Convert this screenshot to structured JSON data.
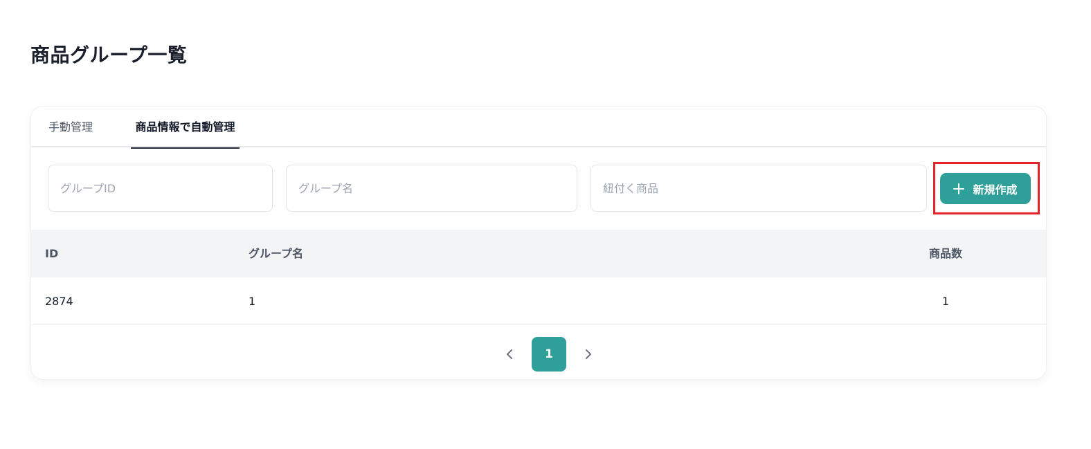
{
  "page": {
    "title": "商品グループ一覧"
  },
  "tabs": [
    {
      "label": "手動管理",
      "active": false
    },
    {
      "label": "商品情報で自動管理",
      "active": true
    }
  ],
  "filters": {
    "group_id": {
      "placeholder": "グループID",
      "value": ""
    },
    "group_name": {
      "placeholder": "グループ名",
      "value": ""
    },
    "linked_product": {
      "placeholder": "紐付く商品",
      "value": ""
    }
  },
  "actions": {
    "create_label": "新規作成",
    "create_icon": "plus-icon"
  },
  "table": {
    "columns": [
      "ID",
      "グループ名",
      "商品数"
    ],
    "rows": [
      {
        "id": "2874",
        "name": "1",
        "count": "1"
      }
    ]
  },
  "pagination": {
    "current_page": "1",
    "prev_icon": "chevron-left-icon",
    "next_icon": "chevron-right-icon"
  },
  "colors": {
    "accent": "#2e9f99",
    "highlight": "#e4222b"
  }
}
